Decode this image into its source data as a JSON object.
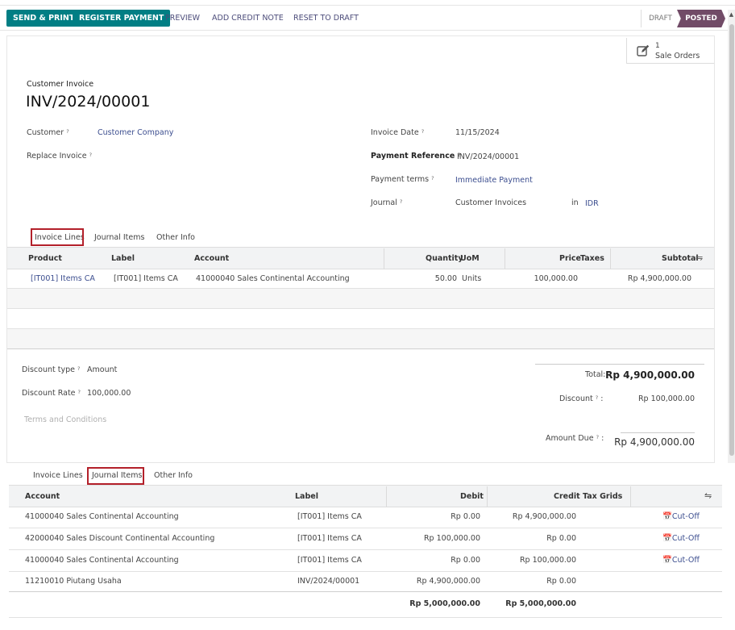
{
  "toolbar": {
    "send_print": "SEND & PRINT",
    "register_payment": "REGISTER PAYMENT",
    "preview": "PREVIEW",
    "add_credit_note": "ADD CREDIT NOTE",
    "reset_to_draft": "RESET TO DRAFT",
    "status_draft": "DRAFT",
    "status_posted": "POSTED"
  },
  "smart_button": {
    "count": "1",
    "label": "Sale Orders",
    "icon": "edit-icon"
  },
  "invoice": {
    "type": "Customer Invoice",
    "number": "INV/2024/00001",
    "customer_label": "Customer",
    "customer_value": "Customer Company",
    "replace_label": "Replace Invoice",
    "date_label": "Invoice Date",
    "date_value": "11/15/2024",
    "payref_label": "Payment Reference",
    "payref_value": "INV/2024/00001",
    "terms_label": "Payment terms",
    "terms_value": "Immediate Payment",
    "journal_label": "Journal",
    "journal_value": "Customer Invoices",
    "journal_in": "in",
    "currency": "IDR",
    "help_mark": "?"
  },
  "tabs": {
    "invoice_lines": "Invoice Lines",
    "journal_items": "Journal Items",
    "other_info": "Other Info"
  },
  "lines_table": {
    "headers": {
      "product": "Product",
      "label": "Label",
      "account": "Account",
      "quantity": "Quantity",
      "uom": "UoM",
      "price": "Price",
      "taxes": "Taxes",
      "subtotal": "Subtotal"
    },
    "rows": [
      {
        "product": "[IT001] Items CA",
        "label": "[IT001] Items CA",
        "account": "41000040 Sales Continental Accounting",
        "quantity": "50.00",
        "uom": "Units",
        "price": "100,000.00",
        "subtotal": "Rp 4,900,000.00"
      }
    ]
  },
  "discount": {
    "type_label": "Discount type",
    "type_value": "Amount",
    "rate_label": "Discount Rate",
    "rate_value": "100,000.00",
    "terms_placeholder": "Terms and Conditions"
  },
  "totals": {
    "total_label": "Total:",
    "total_value": "Rp 4,900,000.00",
    "discount_label": "Discount",
    "discount_colon": ":",
    "discount_value": "Rp 100,000.00",
    "due_label": "Amount Due",
    "due_colon": ":",
    "due_value": "Rp 4,900,000.00"
  },
  "journal_table": {
    "headers": {
      "account": "Account",
      "label": "Label",
      "debit": "Debit",
      "credit": "Credit",
      "tax_grids": "Tax Grids"
    },
    "rows": [
      {
        "account": "41000040 Sales Continental Accounting",
        "label": "[IT001] Items CA",
        "debit": "Rp 0.00",
        "credit": "Rp 4,900,000.00",
        "cutoff": "Cut-Off"
      },
      {
        "account": "42000040 Sales Discount Continental Accounting",
        "label": "[IT001] Items CA",
        "debit": "Rp 100,000.00",
        "credit": "Rp 0.00",
        "cutoff": "Cut-Off"
      },
      {
        "account": "41000040 Sales Continental Accounting",
        "label": "[IT001] Items CA",
        "debit": "Rp 0.00",
        "credit": "Rp 100,000.00",
        "cutoff": "Cut-Off"
      },
      {
        "account": "11210010 Piutang Usaha",
        "label": "INV/2024/00001",
        "debit": "Rp 4,900,000.00",
        "credit": "Rp 0.00",
        "cutoff": ""
      }
    ],
    "total_debit": "Rp 5,000,000.00",
    "total_credit": "Rp 5,000,000.00"
  },
  "colors": {
    "primary": "#017e84",
    "posted": "#714b67",
    "highlight": "#b3202a",
    "link": "#3c4e8f"
  }
}
